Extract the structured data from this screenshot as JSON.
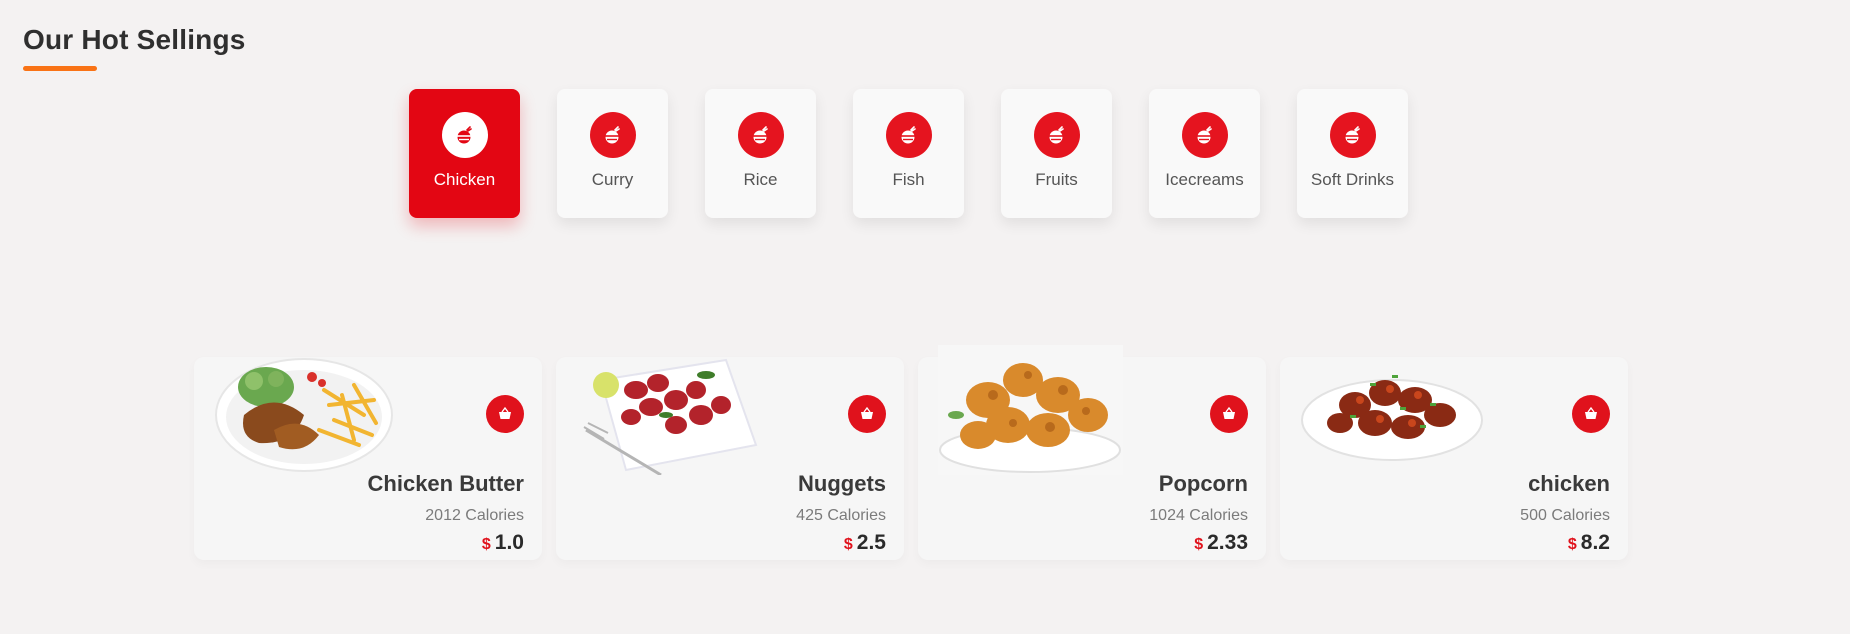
{
  "section": {
    "title": "Our Hot Sellings"
  },
  "categories": [
    {
      "label": "Chicken",
      "active": true,
      "icon": "food-icon"
    },
    {
      "label": "Curry",
      "active": false,
      "icon": "food-icon"
    },
    {
      "label": "Rice",
      "active": false,
      "icon": "food-icon"
    },
    {
      "label": "Fish",
      "active": false,
      "icon": "food-icon"
    },
    {
      "label": "Fruits",
      "active": false,
      "icon": "food-icon"
    },
    {
      "label": "Icecreams",
      "active": false,
      "icon": "food-icon"
    },
    {
      "label": "Soft Drinks",
      "active": false,
      "icon": "food-icon"
    }
  ],
  "items": [
    {
      "name": "Chicken Butter",
      "calories": "2012 Calories",
      "currency": "$",
      "price": "1.0",
      "image": "chicken-with-fries-plate"
    },
    {
      "name": "Nuggets",
      "calories": "425 Calories",
      "currency": "$",
      "price": "2.5",
      "image": "red-nuggets-plate"
    },
    {
      "name": "Popcorn",
      "calories": "1024 Calories",
      "currency": "$",
      "price": "2.33",
      "image": "fried-chicken-popcorn-plate"
    },
    {
      "name": "chicken",
      "calories": "500 Calories",
      "currency": "$",
      "price": "8.2",
      "image": "chilli-chicken-bowl"
    }
  ],
  "colors": {
    "accent": "#e30613",
    "underline": "#f97316",
    "background": "#f4f2f2"
  }
}
